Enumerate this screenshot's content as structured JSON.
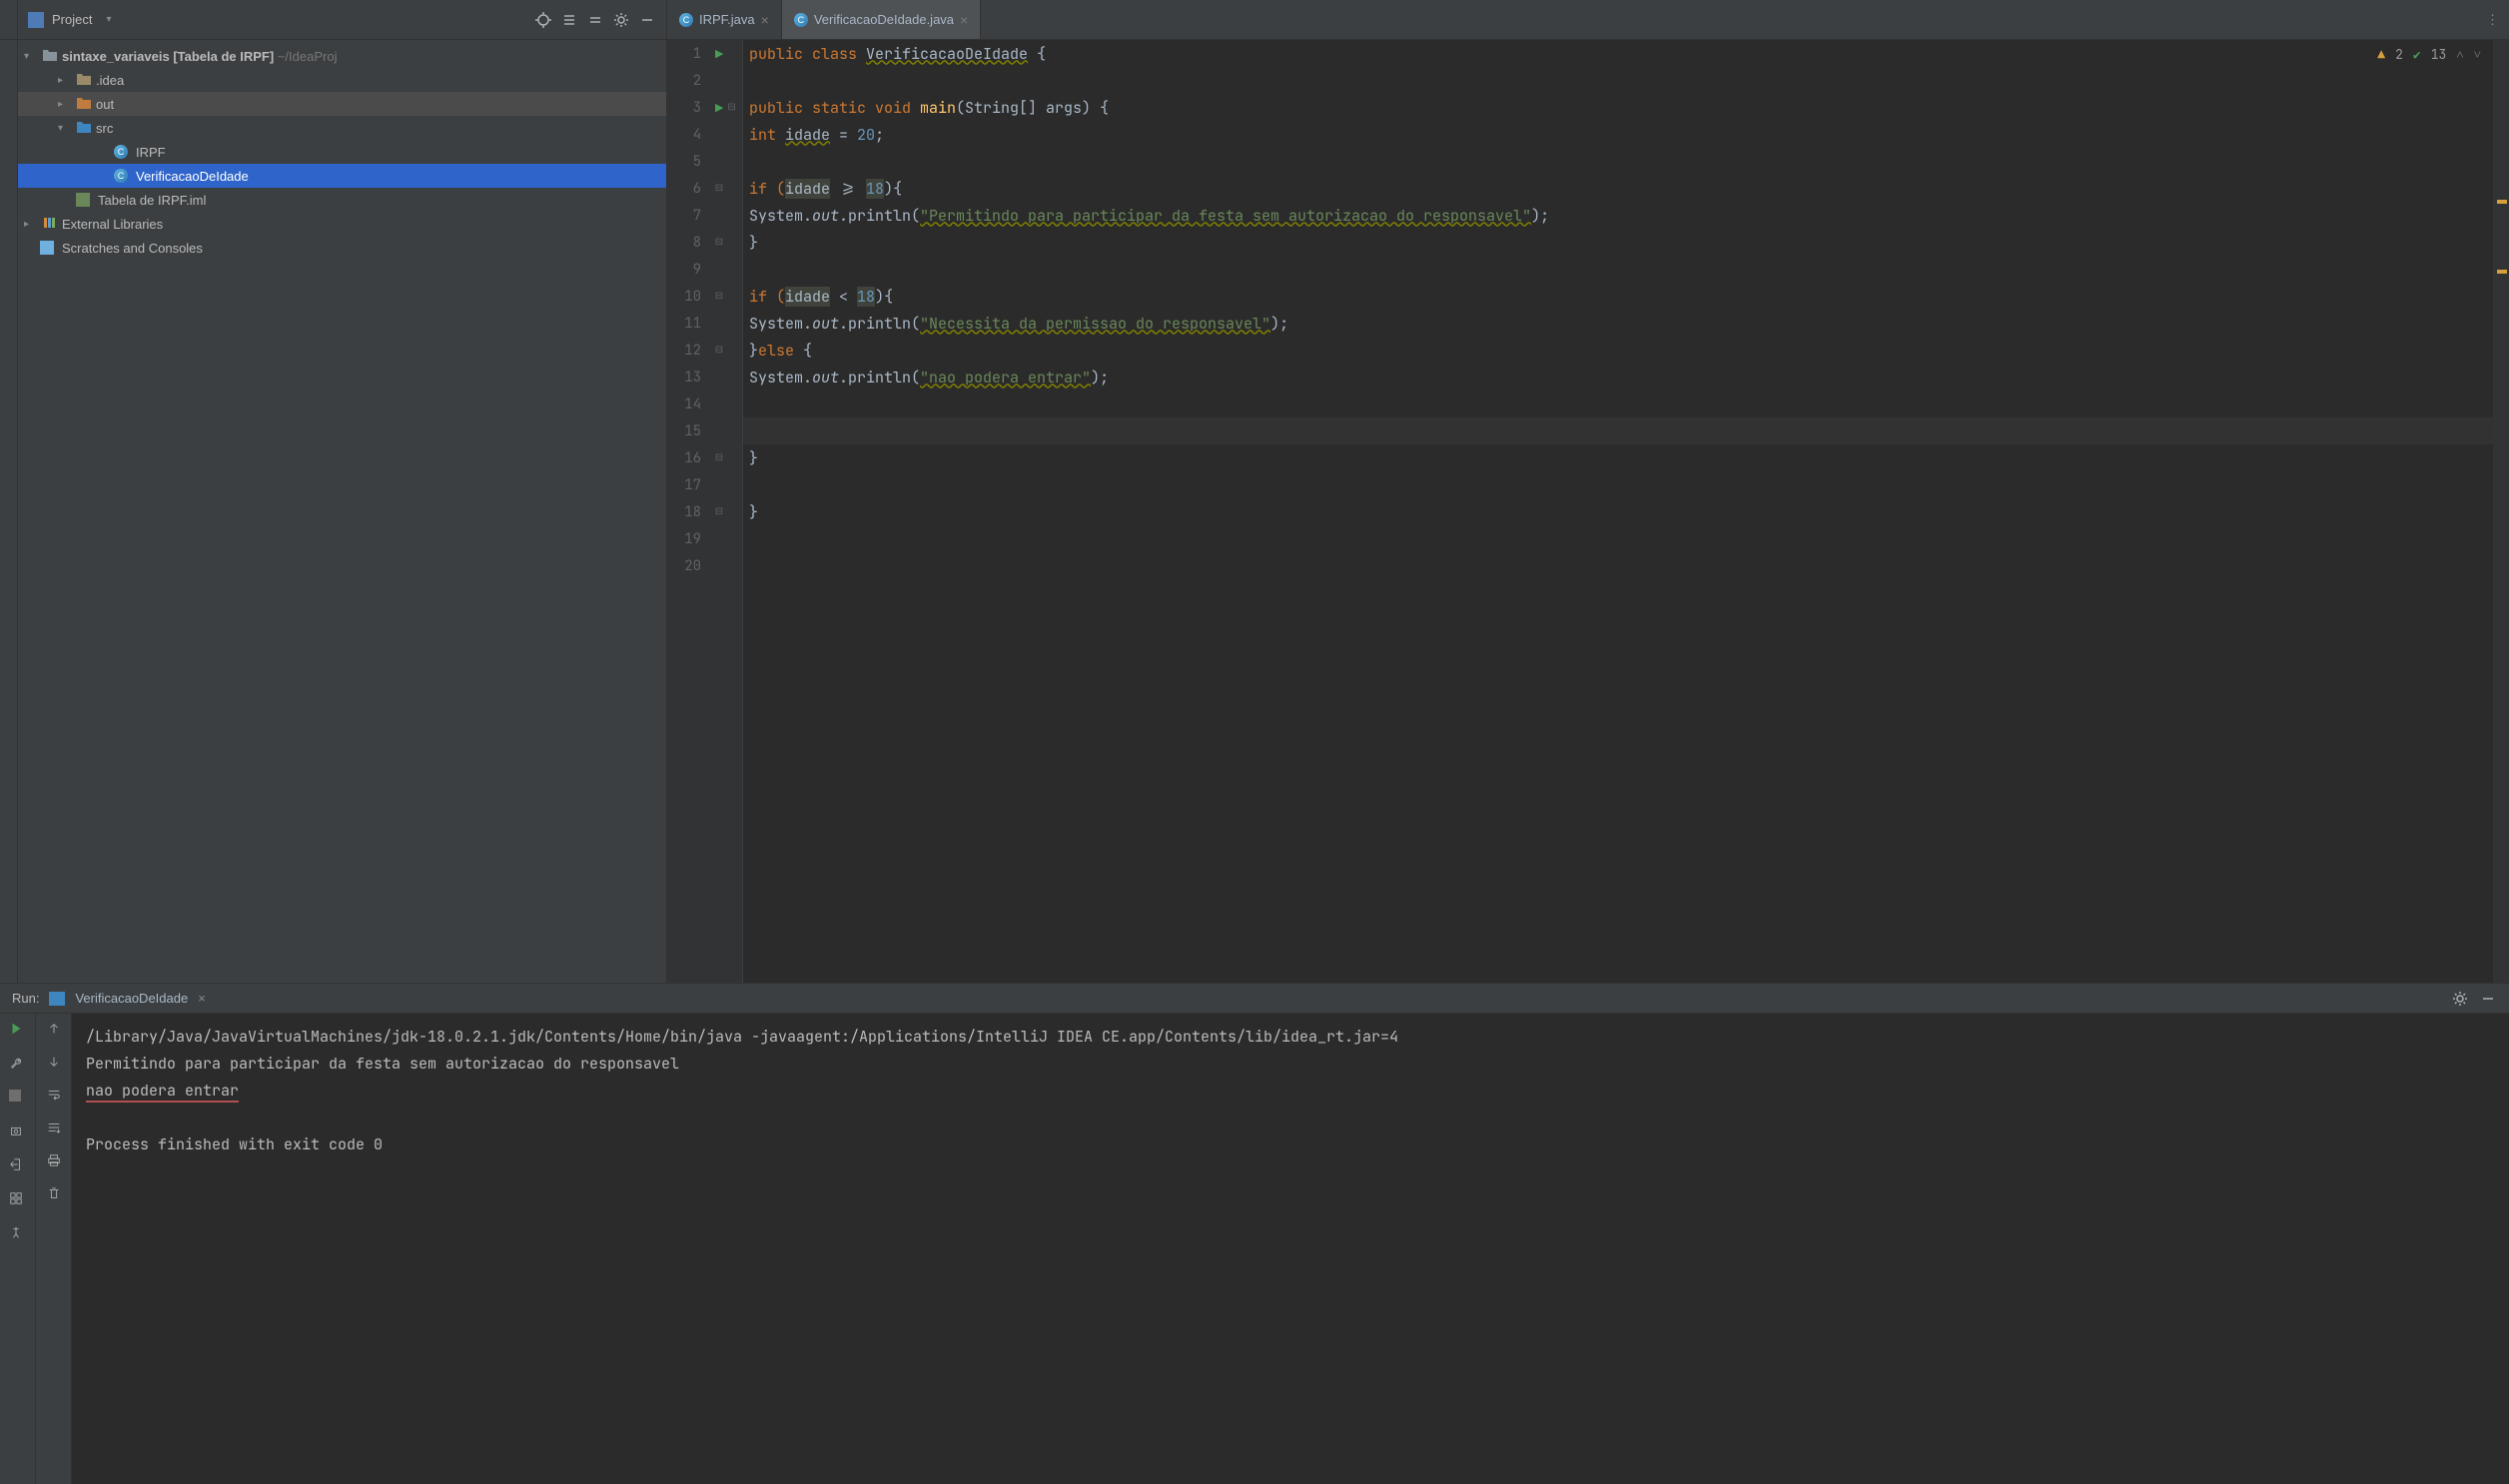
{
  "colors": {
    "accent": "#2f65ca",
    "keyword": "#cc7832",
    "string": "#6a8759",
    "number": "#6897bb",
    "warn": "#d6a13c",
    "run": "#499c54"
  },
  "project_panel": {
    "title": "Project",
    "root": "sintaxe_variaveis",
    "root_suffix": " [Tabela de IRPF]",
    "root_path": "~/IdeaProj",
    "idea_folder": ".idea",
    "out_folder": "out",
    "src_folder": "src",
    "file_irpf": "IRPF",
    "file_verif": "VerificacaoDeIdade",
    "file_iml": "Tabela de IRPF.iml",
    "external_libs": "External Libraries",
    "scratches": "Scratches and Consoles"
  },
  "tabs": [
    {
      "label": "IRPF.java",
      "active": false
    },
    {
      "label": "VerificacaoDeIdade.java",
      "active": true
    }
  ],
  "inspections": {
    "warnings": "2",
    "passes": "13"
  },
  "code": {
    "class_kw": "public class ",
    "class_name": "VerificacaoDeIdade",
    "brace_open": " {",
    "main_sig_pre": "public static void ",
    "main_name": "main",
    "main_args": "(String[] args) {",
    "idade_decl_kw": "int ",
    "idade_name": "idade",
    "idade_assign": " = ",
    "idade_val": "20",
    "semi": ";",
    "if1_pre": "if (",
    "if1_cond_id": "idade",
    "if1_cond_op": " >= ",
    "if1_cond_num": "18",
    "if1_post": "){",
    "print1_pre": "System.",
    "print1_out": "out",
    "print1_call": ".println(",
    "print1_str1": "\"Permitindo para participar da festa sem autorizacao do responsavel\"",
    "print1_end": ");",
    "brace_close_inner": "}",
    "if2_pre": "if (",
    "if2_cond_id": "idade",
    "if2_cond_op": " < ",
    "if2_cond_num": "18",
    "if2_post": "){",
    "print2_str": "\"Necessita da permissao do responsavel\"",
    "else_line": "}else {",
    "print3_str": "\"nao podera entrar\"",
    "line_numbers": [
      "1",
      "2",
      "3",
      "4",
      "5",
      "6",
      "7",
      "8",
      "9",
      "10",
      "11",
      "12",
      "13",
      "14",
      "15",
      "16",
      "17",
      "18",
      "19",
      "20"
    ]
  },
  "run_panel": {
    "label": "Run:",
    "tab": "VerificacaoDeIdade",
    "cmd": "/Library/Java/JavaVirtualMachines/jdk-18.0.2.1.jdk/Contents/Home/bin/java -javaagent:/Applications/IntelliJ IDEA CE.app/Contents/lib/idea_rt.jar=4",
    "out1": "Permitindo para participar da festa sem autorizacao do responsavel",
    "out2": "nao podera entrar",
    "exit": "Process finished with exit code 0"
  }
}
